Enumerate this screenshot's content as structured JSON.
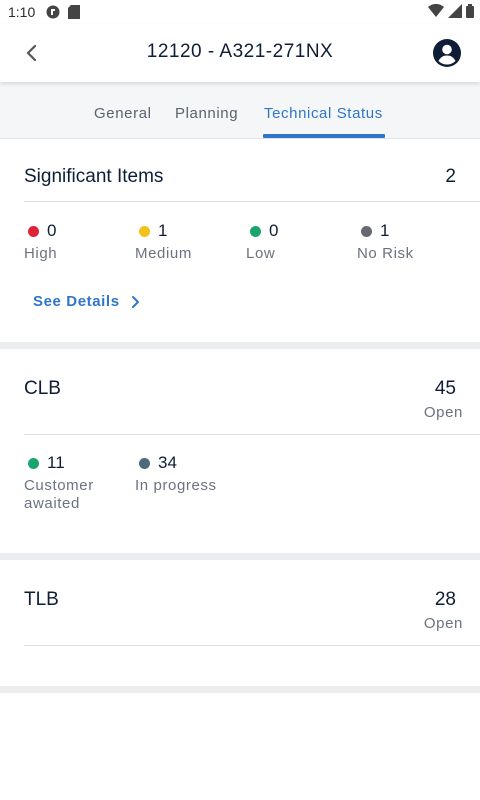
{
  "status_bar": {
    "time": "1:10"
  },
  "header": {
    "title": "12120 - A321-271NX"
  },
  "tabs": [
    {
      "label": "General",
      "active": false
    },
    {
      "label": "Planning",
      "active": false
    },
    {
      "label": "Technical Status",
      "active": true
    }
  ],
  "significant_items": {
    "title": "Significant Items",
    "count": "2",
    "stats": [
      {
        "value": "0",
        "label": "High",
        "color": "#e0213a"
      },
      {
        "value": "1",
        "label": "Medium",
        "color": "#f2c21b"
      },
      {
        "value": "0",
        "label": "Low",
        "color": "#1aa56f"
      },
      {
        "value": "1",
        "label": "No Risk",
        "color": "#666a70"
      }
    ],
    "see_details_label": "See Details"
  },
  "clb": {
    "title": "CLB",
    "count": "45",
    "sub": "Open",
    "stats": [
      {
        "value": "11",
        "label": "Customer awaited",
        "color": "#1aa56f"
      },
      {
        "value": "34",
        "label": "In progress",
        "color": "#4c6a78"
      }
    ]
  },
  "tlb": {
    "title": "TLB",
    "count": "28",
    "sub": "Open"
  }
}
